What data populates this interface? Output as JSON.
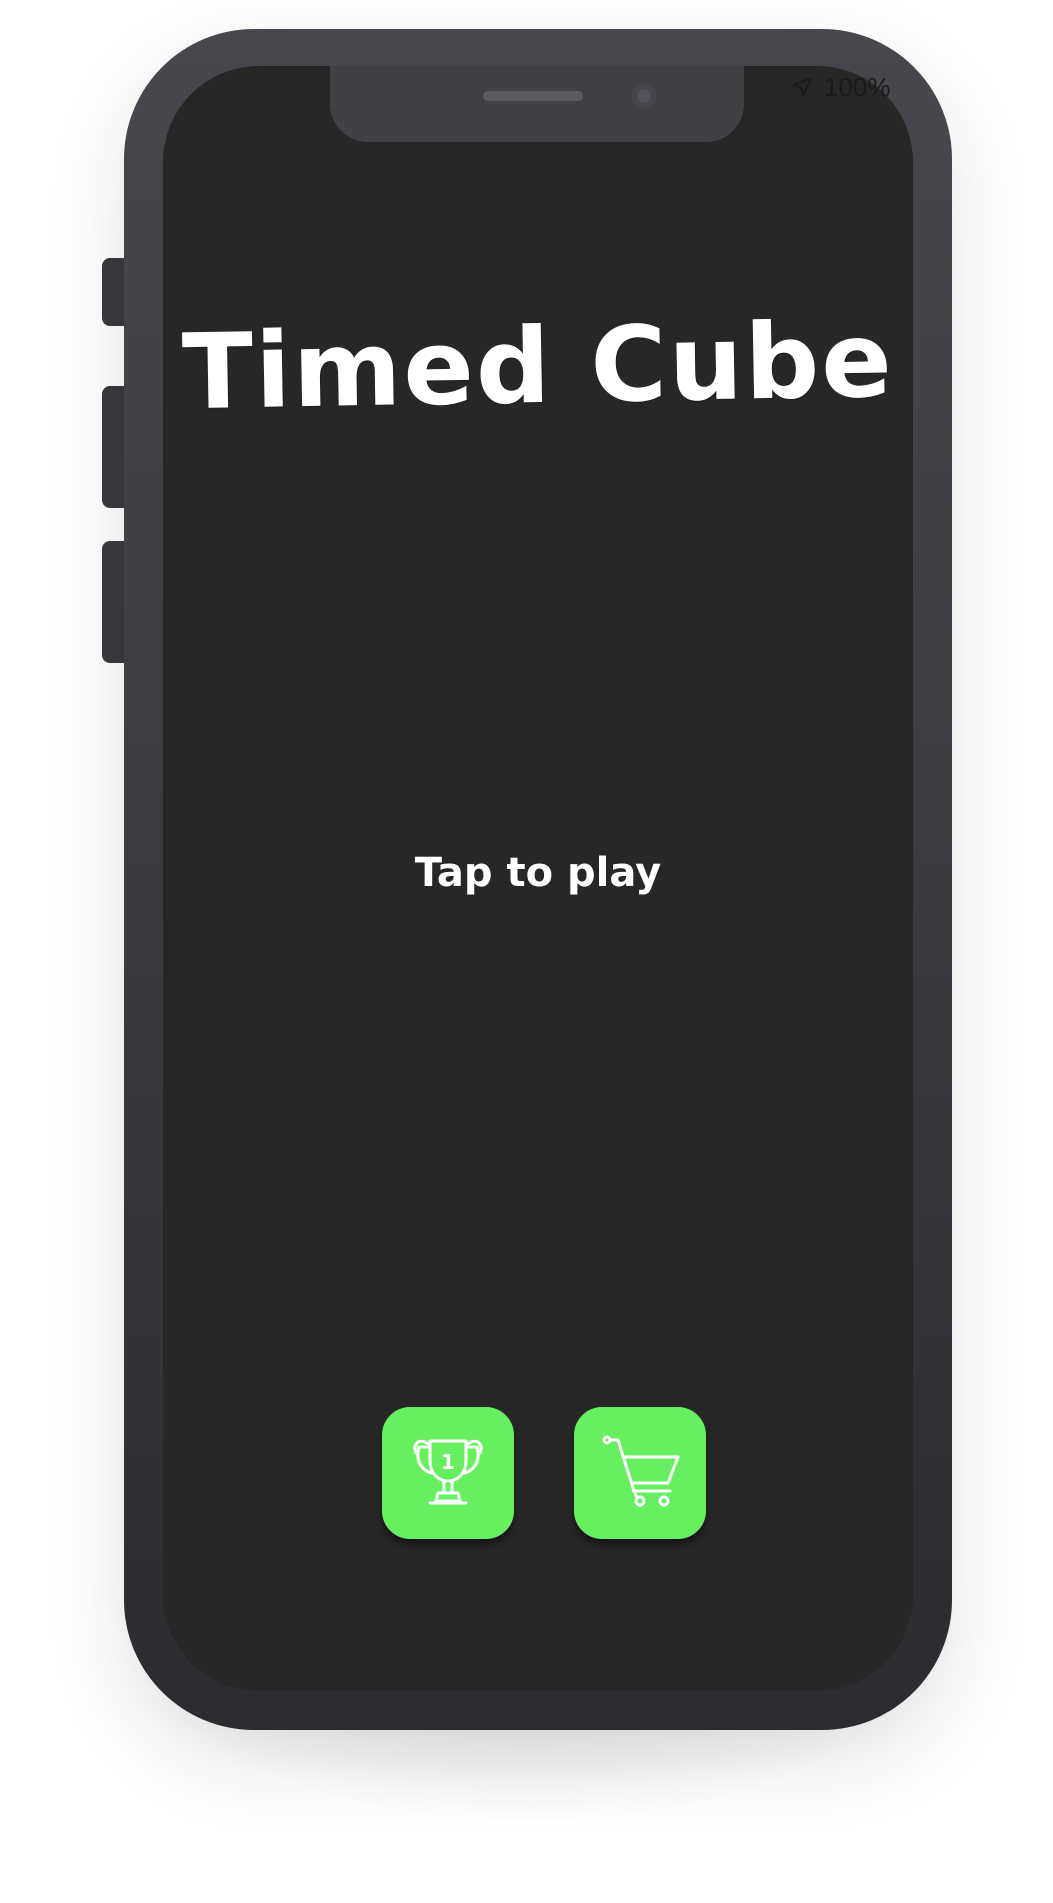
{
  "status_bar": {
    "location_icon": "location-arrow-icon",
    "battery_text": "100%"
  },
  "main": {
    "title": "Timed Cube",
    "tap_prompt": "Tap to play"
  },
  "buttons": {
    "leaderboard": {
      "icon": "trophy-icon",
      "badge": "1"
    },
    "shop": {
      "icon": "shopping-cart-icon"
    }
  },
  "colors": {
    "background": "#272727",
    "button_accent": "#66ef61",
    "text": "#ffffff"
  }
}
